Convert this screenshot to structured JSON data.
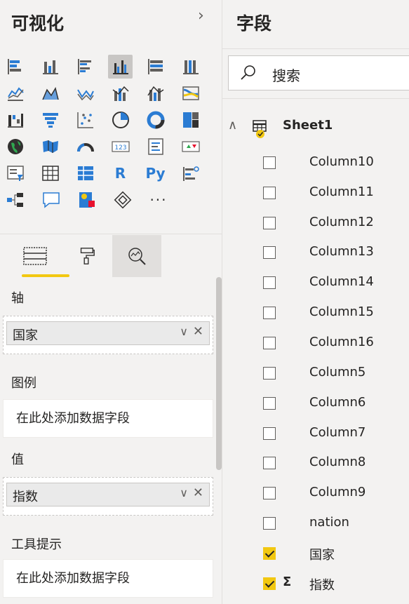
{
  "visualizations": {
    "title": "可视化",
    "collapse_icon": "chevron-right-icon",
    "icons": [
      [
        "stacked-bar-chart-icon",
        "stacked-column-chart-icon",
        "clustered-bar-chart-icon",
        "clustered-column-chart-icon",
        "100-stacked-bar-chart-icon",
        "100-stacked-column-chart-icon"
      ],
      [
        "line-chart-icon",
        "area-chart-icon",
        "stacked-area-chart-icon",
        "line-clustered-column-icon",
        "line-stacked-column-icon",
        "ribbon-chart-icon"
      ],
      [
        "waterfall-chart-icon",
        "funnel-icon",
        "scatter-chart-icon",
        "pie-chart-icon",
        "donut-chart-icon",
        "treemap-icon"
      ],
      [
        "map-icon",
        "filled-map-icon",
        "gauge-icon",
        "card-icon",
        "multi-row-card-icon",
        "kpi-icon"
      ],
      [
        "slicer-icon",
        "table-icon",
        "matrix-icon",
        "r-visual-icon",
        "python-visual-icon",
        "key-influencers-icon"
      ],
      [
        "decomposition-tree-icon",
        "qa-icon",
        "smart-narrative-icon",
        "power-apps-icon",
        "more-visuals-icon"
      ]
    ],
    "r_label": "R",
    "py_label": "Py",
    "card_label": "123",
    "more_label": "···",
    "tabs": [
      "fields-tab",
      "format-tab",
      "analytics-tab"
    ]
  },
  "wells": {
    "axis": {
      "label": "轴",
      "field": "国家"
    },
    "legend": {
      "label": "图例",
      "placeholder": "在此处添加数据字段"
    },
    "values": {
      "label": "值",
      "field": "指数"
    },
    "tooltips": {
      "label": "工具提示",
      "placeholder": "在此处添加数据字段"
    }
  },
  "fields_pane": {
    "title": "字段",
    "search_placeholder": "搜索",
    "table_name": "Sheet1",
    "fields": [
      {
        "name": "Column10",
        "checked": false,
        "sigma": false
      },
      {
        "name": "Column11",
        "checked": false,
        "sigma": false
      },
      {
        "name": "Column12",
        "checked": false,
        "sigma": false
      },
      {
        "name": "Column13",
        "checked": false,
        "sigma": false
      },
      {
        "name": "Column14",
        "checked": false,
        "sigma": false
      },
      {
        "name": "Column15",
        "checked": false,
        "sigma": false
      },
      {
        "name": "Column16",
        "checked": false,
        "sigma": false
      },
      {
        "name": "Column5",
        "checked": false,
        "sigma": false
      },
      {
        "name": "Column6",
        "checked": false,
        "sigma": false
      },
      {
        "name": "Column7",
        "checked": false,
        "sigma": false
      },
      {
        "name": "Column8",
        "checked": false,
        "sigma": false
      },
      {
        "name": "Column9",
        "checked": false,
        "sigma": false
      },
      {
        "name": "nation",
        "checked": false,
        "sigma": false
      },
      {
        "name": "国家",
        "checked": true,
        "sigma": false
      },
      {
        "name": "指数",
        "checked": true,
        "sigma": true
      }
    ],
    "sigma_symbol": "Σ"
  },
  "colors": {
    "accent_yellow": "#f2c811",
    "icon_blue": "#2b7cd3",
    "icon_gray": "#605e5c",
    "pane_bg": "#f3f2f1"
  }
}
